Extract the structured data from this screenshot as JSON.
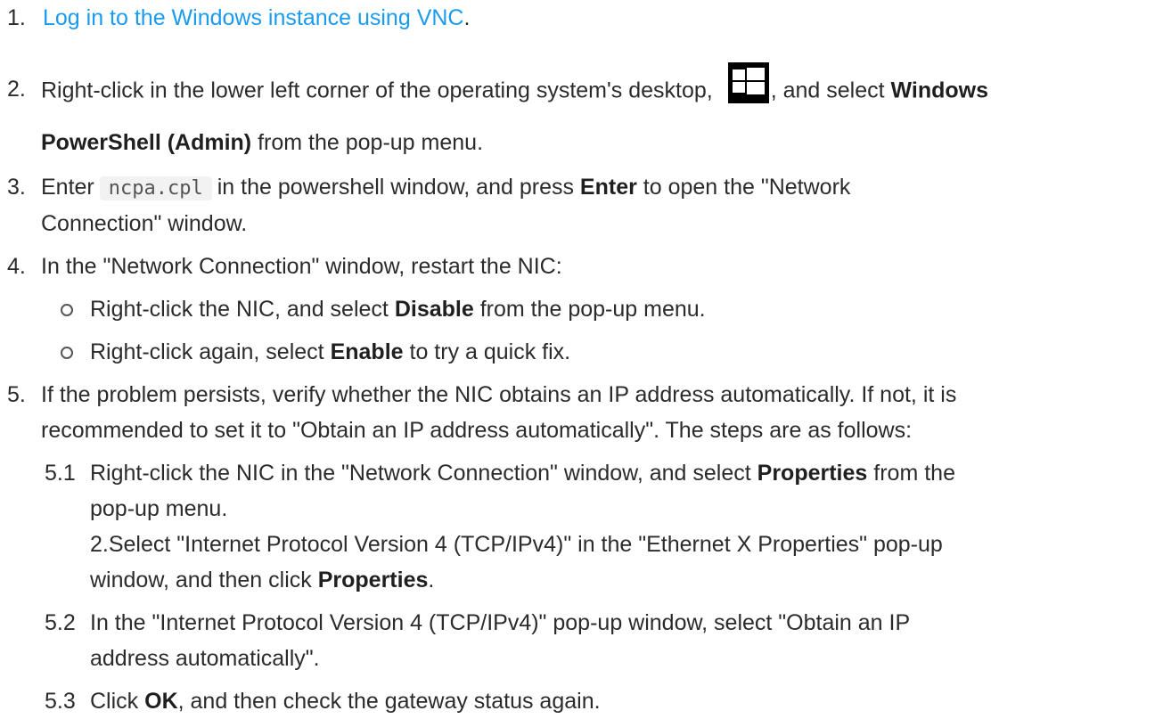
{
  "steps": {
    "s1": {
      "number": "1.",
      "link": "Log in to the Windows instance using VNC",
      "tail": "."
    },
    "s2": {
      "number": "2.",
      "text_a": "Right-click in the lower left corner of the operating system's desktop,",
      "icon": "windows-logo-icon",
      "text_b": ", and select",
      "bold_a": "Windows",
      "bold_b": "PowerShell (Admin)",
      "text_c": "from the pop-up menu."
    },
    "s3": {
      "number": "3.",
      "text_a": "Enter",
      "code": "ncpa.cpl",
      "text_b": "in the powershell window, and press",
      "bold": "Enter",
      "text_c": "to open the \"Network",
      "text_d": "Connection\" window."
    },
    "s4": {
      "number": "4.",
      "text": "In the \"Network Connection\" window, restart the NIC:",
      "bullets": [
        {
          "text_a": "Right-click the NIC, and select",
          "bold": "Disable",
          "text_b": "from the pop-up menu."
        },
        {
          "text_a": "Right-click again, select",
          "bold": "Enable",
          "text_b": "to try a quick fix."
        }
      ]
    },
    "s5": {
      "number": "5.",
      "line1": "If the problem persists, verify whether the NIC obtains an IP address automatically. If not, it is",
      "line2": "recommended to set it to \"Obtain an IP address automatically\". The steps are as follows:",
      "sub": {
        "s51": {
          "number": "5.1",
          "text_a": "Right-click the NIC in the \"Network Connection\" window, and select",
          "bold": "Properties",
          "text_b": "from the",
          "line2": "pop-up menu.",
          "line3": "2.Select \"Internet Protocol Version 4 (TCP/IPv4)\" in the \"Ethernet X Properties\" pop-up",
          "line4_a": "window, and then click",
          "line4_bold": "Properties",
          "line4_tail": "."
        },
        "s52": {
          "number": "5.2",
          "line1": "In the \"Internet Protocol Version 4 (TCP/IPv4)\" pop-up window, select \"Obtain an IP",
          "line2": "address automatically\"."
        },
        "s53": {
          "number": "5.3",
          "text_a": "Click",
          "bold": "OK",
          "text_b": ", and then check the gateway status again."
        }
      }
    }
  },
  "colors": {
    "link": "#1a9bf0",
    "text": "#2b2b2b",
    "code_bg": "#f2f2f2"
  }
}
